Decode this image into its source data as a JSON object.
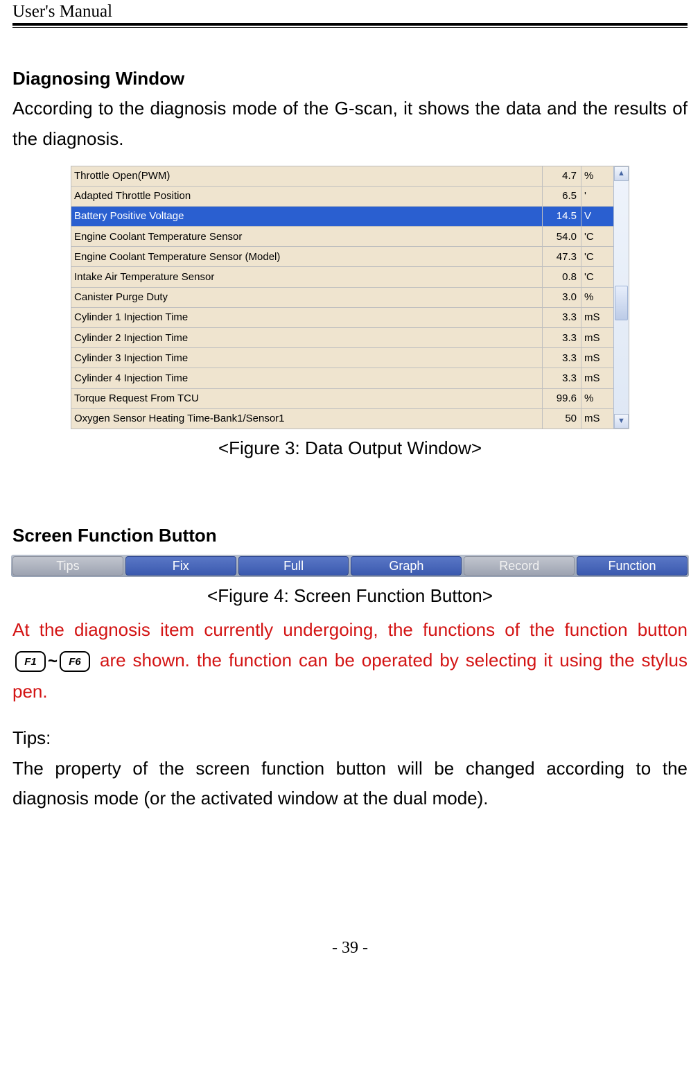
{
  "header": {
    "title": "User's Manual"
  },
  "section1": {
    "title": "Diagnosing Window",
    "body": "According to the diagnosis mode of the G-scan, it shows the data and the results of the diagnosis."
  },
  "grid": {
    "rows": [
      {
        "name": "Throttle Open(PWM)",
        "value": "4.7",
        "unit": "%",
        "selected": false
      },
      {
        "name": "Adapted Throttle Position",
        "value": "6.5",
        "unit": "'",
        "selected": false
      },
      {
        "name": "Battery Positive Voltage",
        "value": "14.5",
        "unit": "V",
        "selected": true
      },
      {
        "name": "Engine Coolant Temperature Sensor",
        "value": "54.0",
        "unit": "'C",
        "selected": false
      },
      {
        "name": "Engine Coolant Temperature Sensor (Model)",
        "value": "47.3",
        "unit": "'C",
        "selected": false
      },
      {
        "name": "Intake Air Temperature Sensor",
        "value": "0.8",
        "unit": "'C",
        "selected": false
      },
      {
        "name": "Canister Purge Duty",
        "value": "3.0",
        "unit": "%",
        "selected": false
      },
      {
        "name": "Cylinder 1 Injection Time",
        "value": "3.3",
        "unit": "mS",
        "selected": false
      },
      {
        "name": "Cylinder 2 Injection Time",
        "value": "3.3",
        "unit": "mS",
        "selected": false
      },
      {
        "name": "Cylinder 3 Injection Time",
        "value": "3.3",
        "unit": "mS",
        "selected": false
      },
      {
        "name": "Cylinder 4 Injection Time",
        "value": "3.3",
        "unit": "mS",
        "selected": false
      },
      {
        "name": "Torque Request From TCU",
        "value": "99.6",
        "unit": "%",
        "selected": false
      },
      {
        "name": "Oxygen Sensor Heating Time-Bank1/Sensor1",
        "value": "50",
        "unit": "mS",
        "selected": false
      }
    ]
  },
  "caption1": "<Figure 3: Data Output Window>",
  "section2": {
    "title": "Screen Function Button",
    "buttons": [
      {
        "label": "Tips",
        "enabled": false
      },
      {
        "label": "Fix",
        "enabled": true
      },
      {
        "label": "Full",
        "enabled": true
      },
      {
        "label": "Graph",
        "enabled": true
      },
      {
        "label": "Record",
        "enabled": false
      },
      {
        "label": "Function",
        "enabled": true
      }
    ]
  },
  "caption2": "<Figure 4: Screen Function Button>",
  "red": {
    "part1": "At the diagnosis item currently undergoing, the functions of the function button ",
    "key1": "F1",
    "key2": "F6",
    "part2": " are shown. the function can be operated by selecting it using the stylus pen."
  },
  "tips": {
    "label": "Tips:",
    "body": "The property of the screen function button will be changed according to the diagnosis mode (or the activated window at the dual mode)."
  },
  "footer": {
    "page": "- 39 -"
  }
}
